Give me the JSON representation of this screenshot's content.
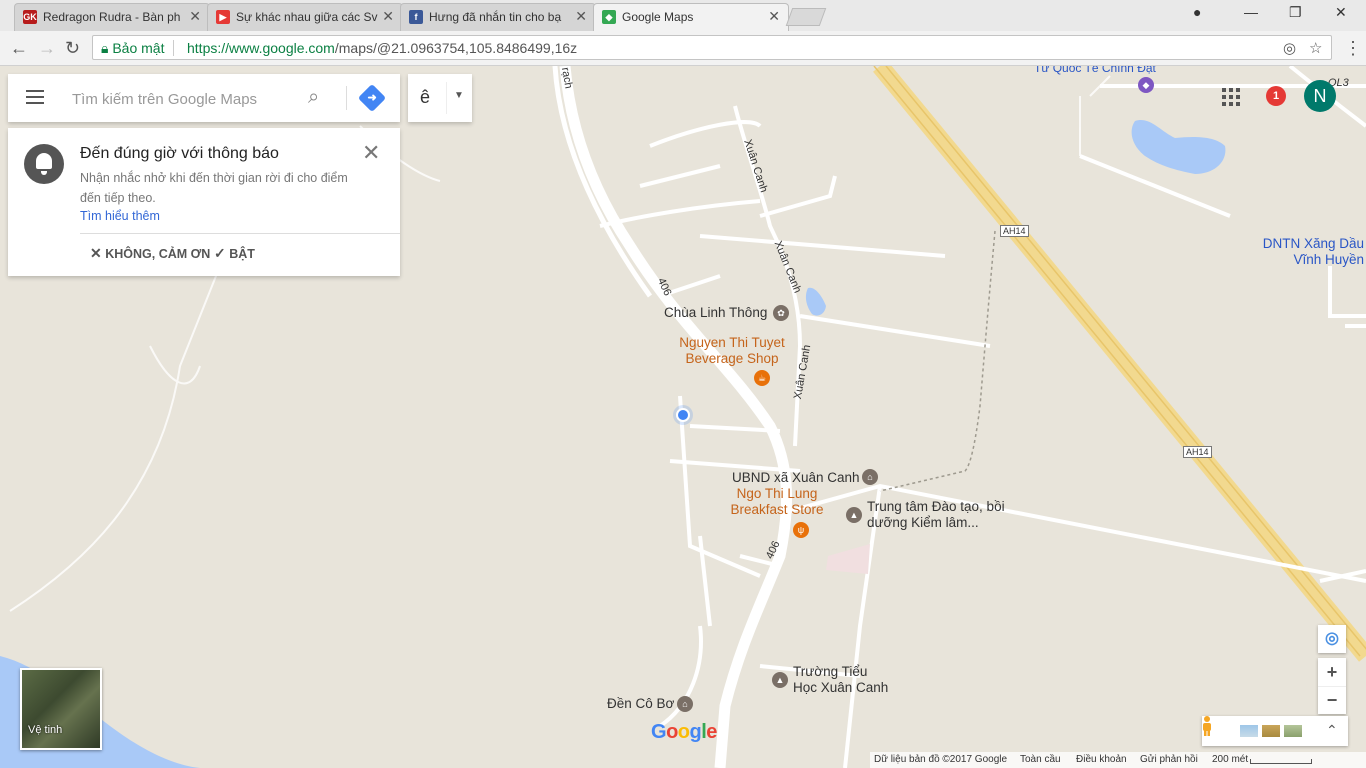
{
  "browser": {
    "tabs": [
      {
        "title": "Redragon Rudra - Bàn ph",
        "favicon": "GK",
        "favicon_color": "#b71c1c"
      },
      {
        "title": "Sự khác nhau giữa các Sv",
        "favicon": "▶",
        "favicon_color": "#e53935"
      },
      {
        "title": "Hưng đã nhắn tin cho bạ",
        "favicon": "f",
        "favicon_color": "#3b5998"
      },
      {
        "title": "Google Maps",
        "favicon": "◆",
        "favicon_color": "#34a853"
      }
    ],
    "secure_label": "Bảo mật",
    "url_host": "https://www.google.com",
    "url_path": "/maps/@21.0963754,105.8486499,16z"
  },
  "search": {
    "placeholder": "Tìm kiếm trên Google Maps",
    "lang_label": "ê"
  },
  "notification": {
    "title": "Đến đúng giờ với thông báo",
    "body": "Nhận nhắc nhở khi đến thời gian rời đi cho điểm đến tiếp theo.",
    "learn_more": "Tìm hiểu thêm",
    "decline": "KHÔNG, CẢM ƠN",
    "accept": "BẬT"
  },
  "account": {
    "notification_count": "1",
    "avatar_letter": "N"
  },
  "map": {
    "labels": {
      "road_top": "rạch",
      "road_xuan_canh_1": "Xuân Canh",
      "road_xuan_canh_2": "Xuân Canh",
      "road_xuan_canh_3": "Xuân Canh",
      "road_406_a": "406",
      "road_406_b": "406",
      "hwy_ah14_a": "AH14",
      "hwy_ah14_b": "AH14",
      "ql3": "QL3",
      "top_partial": "Tư Quốc Tế Chính Đạt",
      "dntn": "DNTN Xăng Dầu Vĩnh Huyền",
      "chua": "Chùa Linh Thông",
      "beverage": "Nguyen Thi Tuyet Beverage Shop",
      "ubnd": "UBND xã Xuân Canh",
      "breakfast": "Ngo Thi Lung Breakfast Store",
      "trungtam": "Trung tâm Đào tạo, bồi dưỡng Kiểm lâm...",
      "truong": "Trường Tiểu Học Xuân Canh",
      "den": "Đền Cô Bơ"
    },
    "satellite_label": "Vệ tinh",
    "logo": "Google"
  },
  "footer": {
    "data": "Dữ liệu bản đồ ©2017 Google",
    "global": "Toàn cầu",
    "terms": "Điều khoản",
    "feedback": "Gửi phản hồi",
    "scale": "200 mét"
  }
}
